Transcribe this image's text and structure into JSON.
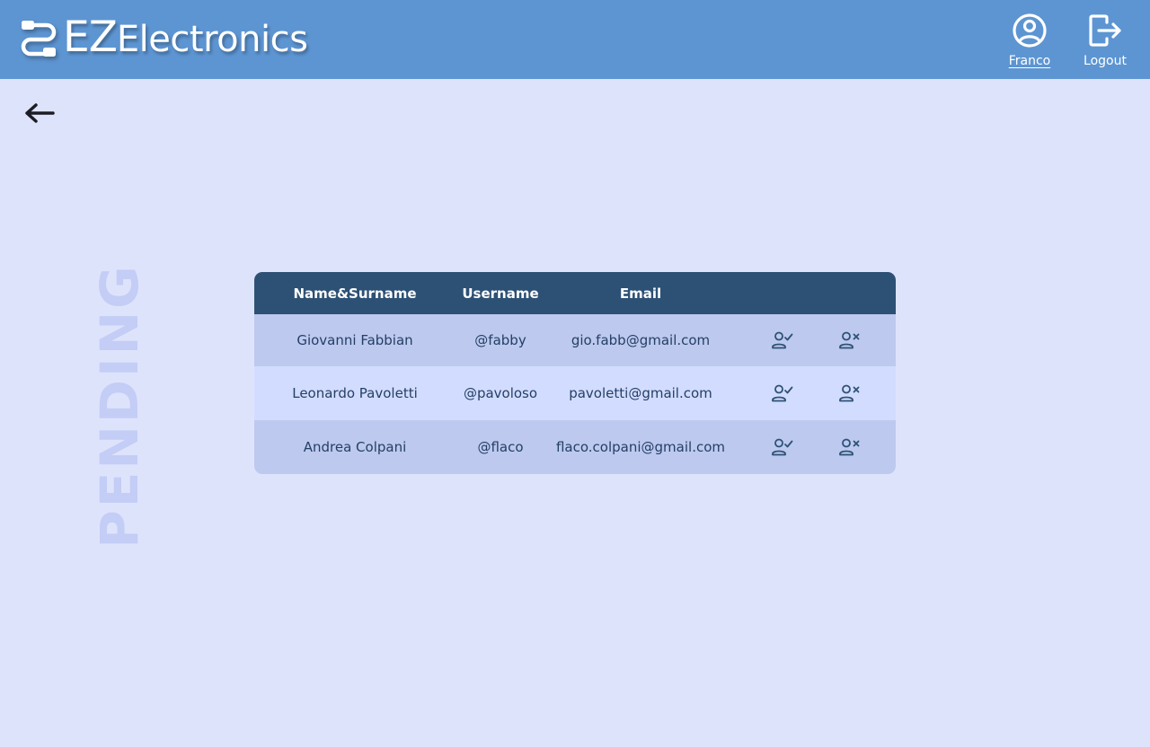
{
  "header": {
    "logo_ez": "EZ",
    "logo_rest": "Electronics",
    "profile_label": "Franco",
    "logout_label": "Logout"
  },
  "page": {
    "section_title": "PENDING"
  },
  "table": {
    "columns": [
      "Name&Surname",
      "Username",
      "Email"
    ],
    "rows": [
      {
        "name": "Giovanni Fabbian",
        "username": "@fabby",
        "email": "gio.fabb@gmail.com"
      },
      {
        "name": "Leonardo Pavoletti",
        "username": "@pavoloso",
        "email": "pavoletti@gmail.com"
      },
      {
        "name": "Andrea Colpani",
        "username": "@flaco",
        "email": "flaco.colpani@gmail.com"
      }
    ]
  },
  "icons": {
    "logo": "cable-connector-icon",
    "profile": "user-circle-icon",
    "logout": "logout-icon",
    "back": "arrow-left-icon",
    "approve": "user-check-icon",
    "reject": "user-x-icon"
  },
  "colors": {
    "header_bg": "#5d95d2",
    "page_bg": "#dee3fc",
    "table_header_bg": "#2d5175",
    "row_alt_a": "#bdc9ee",
    "row_alt_b": "#d2dcff",
    "text_dark": "#243f66",
    "title_faded": "#c3cdf5"
  }
}
